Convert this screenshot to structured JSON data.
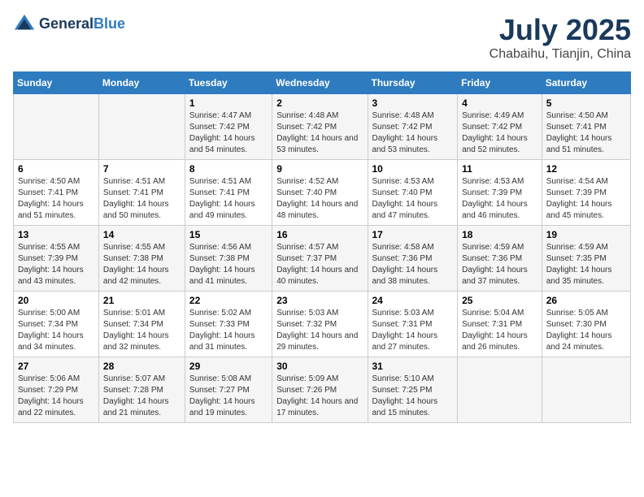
{
  "header": {
    "logo_line1": "General",
    "logo_line2": "Blue",
    "month_title": "July 2025",
    "subtitle": "Chabaihu, Tianjin, China"
  },
  "weekdays": [
    "Sunday",
    "Monday",
    "Tuesday",
    "Wednesday",
    "Thursday",
    "Friday",
    "Saturday"
  ],
  "weeks": [
    [
      {
        "day": "",
        "sunrise": "",
        "sunset": "",
        "daylight": ""
      },
      {
        "day": "",
        "sunrise": "",
        "sunset": "",
        "daylight": ""
      },
      {
        "day": "1",
        "sunrise": "Sunrise: 4:47 AM",
        "sunset": "Sunset: 7:42 PM",
        "daylight": "Daylight: 14 hours and 54 minutes."
      },
      {
        "day": "2",
        "sunrise": "Sunrise: 4:48 AM",
        "sunset": "Sunset: 7:42 PM",
        "daylight": "Daylight: 14 hours and 53 minutes."
      },
      {
        "day": "3",
        "sunrise": "Sunrise: 4:48 AM",
        "sunset": "Sunset: 7:42 PM",
        "daylight": "Daylight: 14 hours and 53 minutes."
      },
      {
        "day": "4",
        "sunrise": "Sunrise: 4:49 AM",
        "sunset": "Sunset: 7:42 PM",
        "daylight": "Daylight: 14 hours and 52 minutes."
      },
      {
        "day": "5",
        "sunrise": "Sunrise: 4:50 AM",
        "sunset": "Sunset: 7:41 PM",
        "daylight": "Daylight: 14 hours and 51 minutes."
      }
    ],
    [
      {
        "day": "6",
        "sunrise": "Sunrise: 4:50 AM",
        "sunset": "Sunset: 7:41 PM",
        "daylight": "Daylight: 14 hours and 51 minutes."
      },
      {
        "day": "7",
        "sunrise": "Sunrise: 4:51 AM",
        "sunset": "Sunset: 7:41 PM",
        "daylight": "Daylight: 14 hours and 50 minutes."
      },
      {
        "day": "8",
        "sunrise": "Sunrise: 4:51 AM",
        "sunset": "Sunset: 7:41 PM",
        "daylight": "Daylight: 14 hours and 49 minutes."
      },
      {
        "day": "9",
        "sunrise": "Sunrise: 4:52 AM",
        "sunset": "Sunset: 7:40 PM",
        "daylight": "Daylight: 14 hours and 48 minutes."
      },
      {
        "day": "10",
        "sunrise": "Sunrise: 4:53 AM",
        "sunset": "Sunset: 7:40 PM",
        "daylight": "Daylight: 14 hours and 47 minutes."
      },
      {
        "day": "11",
        "sunrise": "Sunrise: 4:53 AM",
        "sunset": "Sunset: 7:39 PM",
        "daylight": "Daylight: 14 hours and 46 minutes."
      },
      {
        "day": "12",
        "sunrise": "Sunrise: 4:54 AM",
        "sunset": "Sunset: 7:39 PM",
        "daylight": "Daylight: 14 hours and 45 minutes."
      }
    ],
    [
      {
        "day": "13",
        "sunrise": "Sunrise: 4:55 AM",
        "sunset": "Sunset: 7:39 PM",
        "daylight": "Daylight: 14 hours and 43 minutes."
      },
      {
        "day": "14",
        "sunrise": "Sunrise: 4:55 AM",
        "sunset": "Sunset: 7:38 PM",
        "daylight": "Daylight: 14 hours and 42 minutes."
      },
      {
        "day": "15",
        "sunrise": "Sunrise: 4:56 AM",
        "sunset": "Sunset: 7:38 PM",
        "daylight": "Daylight: 14 hours and 41 minutes."
      },
      {
        "day": "16",
        "sunrise": "Sunrise: 4:57 AM",
        "sunset": "Sunset: 7:37 PM",
        "daylight": "Daylight: 14 hours and 40 minutes."
      },
      {
        "day": "17",
        "sunrise": "Sunrise: 4:58 AM",
        "sunset": "Sunset: 7:36 PM",
        "daylight": "Daylight: 14 hours and 38 minutes."
      },
      {
        "day": "18",
        "sunrise": "Sunrise: 4:59 AM",
        "sunset": "Sunset: 7:36 PM",
        "daylight": "Daylight: 14 hours and 37 minutes."
      },
      {
        "day": "19",
        "sunrise": "Sunrise: 4:59 AM",
        "sunset": "Sunset: 7:35 PM",
        "daylight": "Daylight: 14 hours and 35 minutes."
      }
    ],
    [
      {
        "day": "20",
        "sunrise": "Sunrise: 5:00 AM",
        "sunset": "Sunset: 7:34 PM",
        "daylight": "Daylight: 14 hours and 34 minutes."
      },
      {
        "day": "21",
        "sunrise": "Sunrise: 5:01 AM",
        "sunset": "Sunset: 7:34 PM",
        "daylight": "Daylight: 14 hours and 32 minutes."
      },
      {
        "day": "22",
        "sunrise": "Sunrise: 5:02 AM",
        "sunset": "Sunset: 7:33 PM",
        "daylight": "Daylight: 14 hours and 31 minutes."
      },
      {
        "day": "23",
        "sunrise": "Sunrise: 5:03 AM",
        "sunset": "Sunset: 7:32 PM",
        "daylight": "Daylight: 14 hours and 29 minutes."
      },
      {
        "day": "24",
        "sunrise": "Sunrise: 5:03 AM",
        "sunset": "Sunset: 7:31 PM",
        "daylight": "Daylight: 14 hours and 27 minutes."
      },
      {
        "day": "25",
        "sunrise": "Sunrise: 5:04 AM",
        "sunset": "Sunset: 7:31 PM",
        "daylight": "Daylight: 14 hours and 26 minutes."
      },
      {
        "day": "26",
        "sunrise": "Sunrise: 5:05 AM",
        "sunset": "Sunset: 7:30 PM",
        "daylight": "Daylight: 14 hours and 24 minutes."
      }
    ],
    [
      {
        "day": "27",
        "sunrise": "Sunrise: 5:06 AM",
        "sunset": "Sunset: 7:29 PM",
        "daylight": "Daylight: 14 hours and 22 minutes."
      },
      {
        "day": "28",
        "sunrise": "Sunrise: 5:07 AM",
        "sunset": "Sunset: 7:28 PM",
        "daylight": "Daylight: 14 hours and 21 minutes."
      },
      {
        "day": "29",
        "sunrise": "Sunrise: 5:08 AM",
        "sunset": "Sunset: 7:27 PM",
        "daylight": "Daylight: 14 hours and 19 minutes."
      },
      {
        "day": "30",
        "sunrise": "Sunrise: 5:09 AM",
        "sunset": "Sunset: 7:26 PM",
        "daylight": "Daylight: 14 hours and 17 minutes."
      },
      {
        "day": "31",
        "sunrise": "Sunrise: 5:10 AM",
        "sunset": "Sunset: 7:25 PM",
        "daylight": "Daylight: 14 hours and 15 minutes."
      },
      {
        "day": "",
        "sunrise": "",
        "sunset": "",
        "daylight": ""
      },
      {
        "day": "",
        "sunrise": "",
        "sunset": "",
        "daylight": ""
      }
    ]
  ]
}
